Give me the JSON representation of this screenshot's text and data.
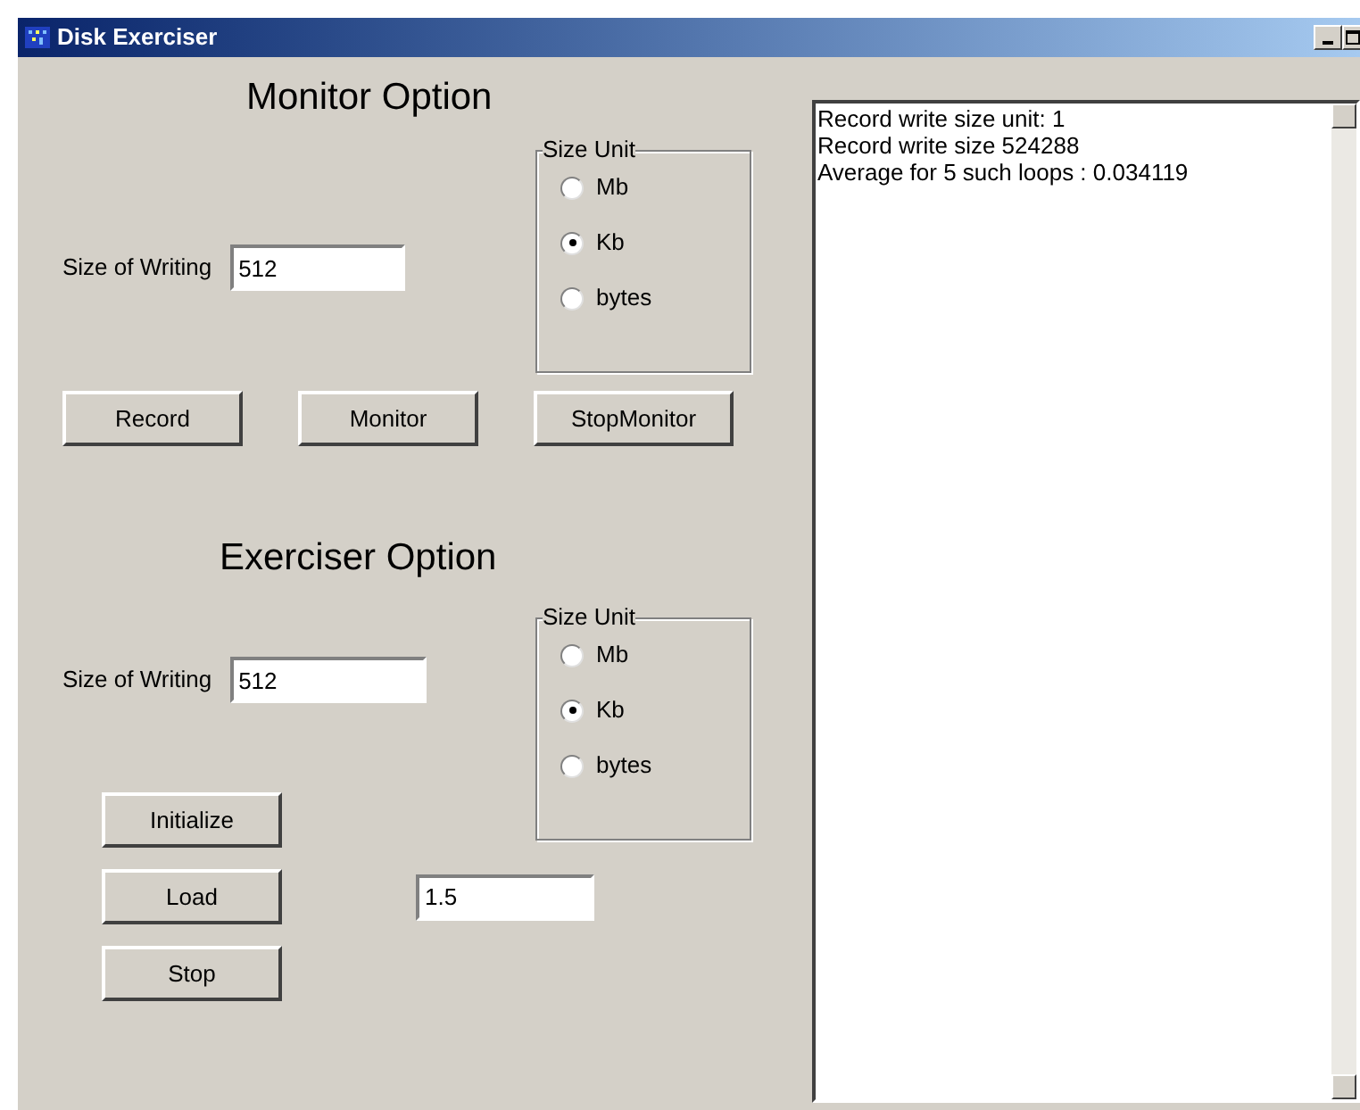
{
  "window": {
    "title": "Disk Exerciser"
  },
  "monitor": {
    "heading": "Monitor Option",
    "size_label": "Size of Writing",
    "size_value": "512",
    "size_unit": {
      "legend": "Size Unit",
      "options": [
        {
          "label": "Mb",
          "selected": false
        },
        {
          "label": "Kb",
          "selected": true
        },
        {
          "label": "bytes",
          "selected": false
        }
      ]
    },
    "buttons": [
      "Record",
      "Monitor",
      "StopMonitor"
    ]
  },
  "exerciser": {
    "heading": "Exerciser Option",
    "size_label": "Size of Writing",
    "size_value": "512",
    "size_unit": {
      "legend": "Size Unit",
      "options": [
        {
          "label": "Mb",
          "selected": false
        },
        {
          "label": "Kb",
          "selected": true
        },
        {
          "label": "bytes",
          "selected": false
        }
      ]
    },
    "buttons": [
      "Initialize",
      "Load",
      "Stop"
    ],
    "load_value": "1.5"
  },
  "log": {
    "lines": [
      "Record write size unit: 1",
      "Record write size 524288",
      "Average for 5 such loops : 0.034119"
    ]
  }
}
